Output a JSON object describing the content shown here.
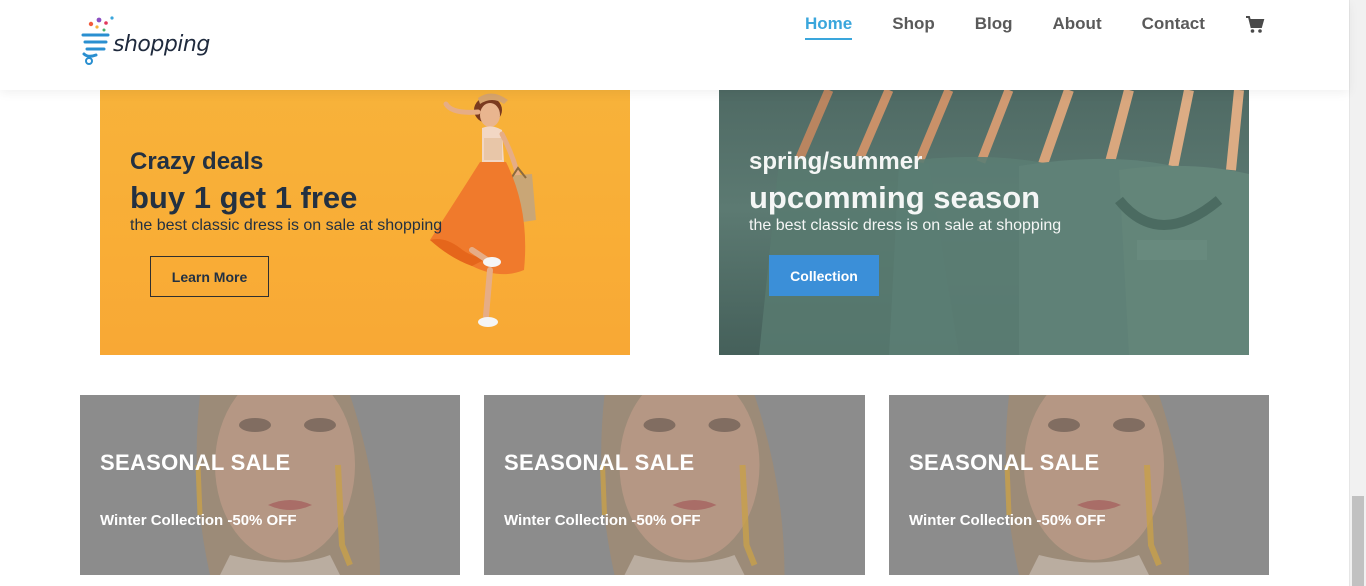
{
  "header": {
    "logo_text": "shopping",
    "nav": [
      {
        "label": "Home",
        "active": true
      },
      {
        "label": "Shop",
        "active": false
      },
      {
        "label": "Blog",
        "active": false
      },
      {
        "label": "About",
        "active": false
      },
      {
        "label": "Contact",
        "active": false
      }
    ],
    "cart_icon": "cart-icon"
  },
  "banners": [
    {
      "subtitle": "Crazy deals",
      "title": "buy 1 get 1 free",
      "description": "the best classic dress is on sale at shopping",
      "button_label": "Learn More"
    },
    {
      "subtitle": "spring/summer",
      "title": "upcomming season",
      "description": "the best classic dress is on sale at shopping",
      "button_label": "Collection"
    }
  ],
  "sale_cards": [
    {
      "title": "SEASONAL SALE",
      "subtitle": "Winter Collection -50% OFF"
    },
    {
      "title": "SEASONAL SALE",
      "subtitle": "Winter Collection -50% OFF"
    },
    {
      "title": "SEASONAL SALE",
      "subtitle": "Winter Collection -50% OFF"
    }
  ],
  "colors": {
    "accent": "#3aa6dc",
    "nav_text": "#5a5a5a",
    "dark_text": "#233142",
    "button_blue": "#3b8fd8",
    "banner_orange": "#f9ad36",
    "banner_green": "#56736c",
    "card_gray": "#8c8c8c"
  }
}
